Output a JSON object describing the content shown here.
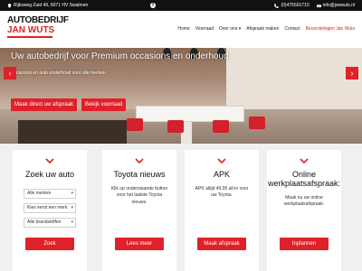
{
  "topbar": {
    "address": "Rijksweg Zuid 49, 6071 HV Swalmen",
    "phone": "(0)475501710",
    "email": "info@janwuts.nl"
  },
  "logo": {
    "line1": "AUTOBEDRIJF",
    "line2": "JAN WUTS"
  },
  "nav": {
    "items": [
      "Home",
      "Voorraad",
      "Over ons ▾",
      "Afspraak maken",
      "Contact"
    ],
    "highlight": "Beoordelingen Jan Wuts"
  },
  "hero": {
    "title": "Uw autobedrijf voor Premium occasions en onderhoud",
    "subtitle": "casions en auto onderhoud voor alle merken",
    "btn_appointment": "Maak direct uw afspraak",
    "btn_inventory": "Bekijk voorraad",
    "arrow_left": "‹",
    "arrow_right": "›"
  },
  "cards": {
    "search": {
      "title": "Zoek uw auto",
      "select1": "Alle merken",
      "select2": "Kies eerst een merk",
      "select3": "Alle brandstoffen",
      "button": "Zoek"
    },
    "toyota": {
      "title": "Toyota nieuws",
      "text": "Klik op onderstaande button voor het laatste Toyota nieuws.",
      "button": "Lees meer"
    },
    "apk": {
      "title": "APK",
      "text": "APK altijd 49,95 all-in voor uw Toyota.",
      "button": "Maak afspraak"
    },
    "online": {
      "title": "Online werkplaatsafspraak:",
      "text": "Maak nu uw online werkplaatsafspraak.",
      "button": "Inplannen"
    }
  },
  "colors": {
    "accent": "#e0212a",
    "topbar": "#111111"
  }
}
